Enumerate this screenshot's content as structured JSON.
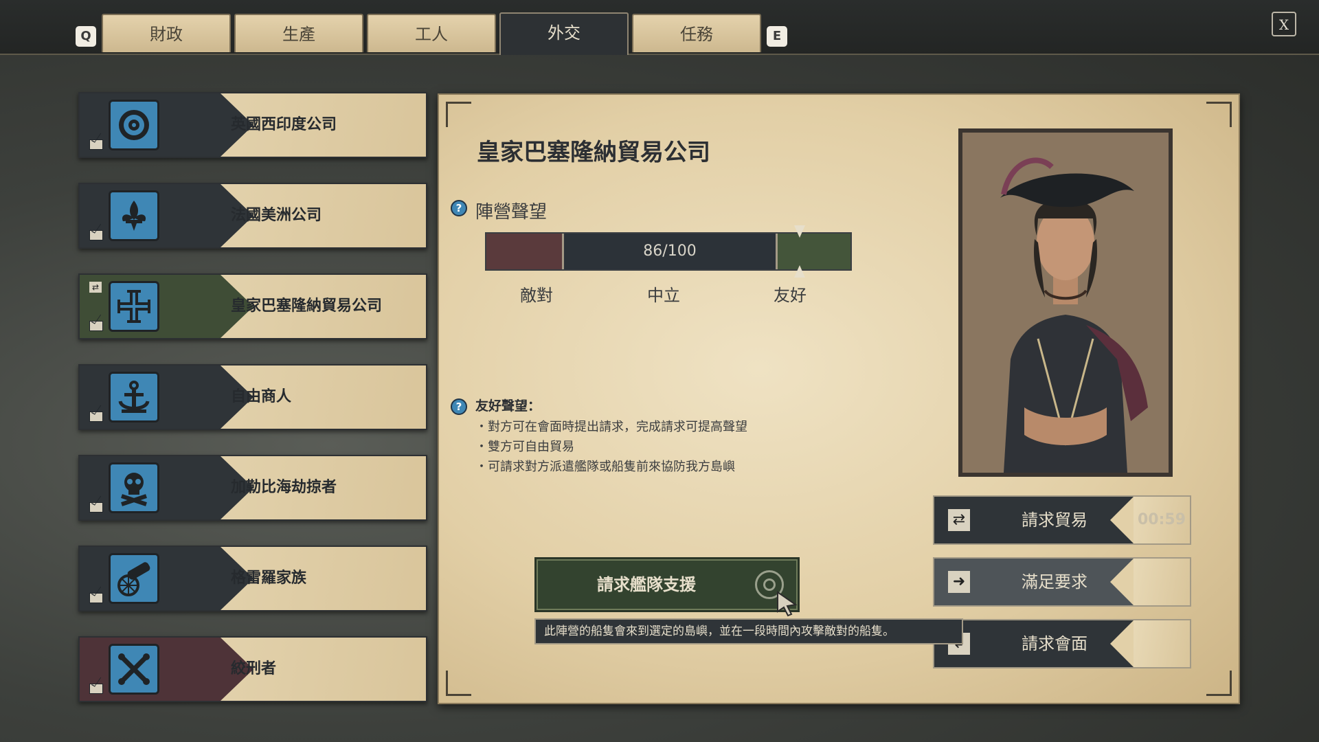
{
  "tabs": {
    "left_key": "Q",
    "right_key": "E",
    "items": [
      {
        "label": "財政"
      },
      {
        "label": "生產"
      },
      {
        "label": "工人"
      },
      {
        "label": "外交"
      },
      {
        "label": "任務"
      }
    ],
    "active_index": 3
  },
  "close_label": "X",
  "factions": [
    {
      "name": "英國西印度公司",
      "icon": "tudor-rose-icon",
      "status": "neutral"
    },
    {
      "name": "法國美洲公司",
      "icon": "fleur-de-lis-icon",
      "status": "neutral"
    },
    {
      "name": "皇家巴塞隆納貿易公司",
      "icon": "cross-icon",
      "status": "friendly",
      "selected": true
    },
    {
      "name": "自由商人",
      "icon": "anchor-icon",
      "status": "neutral"
    },
    {
      "name": "加勒比海劫掠者",
      "icon": "skull-crossbones-icon",
      "status": "neutral"
    },
    {
      "name": "格雷羅家族",
      "icon": "cannon-icon",
      "status": "neutral"
    },
    {
      "name": "絞刑者",
      "icon": "crossed-bones-icon",
      "status": "hostile"
    }
  ],
  "detail": {
    "title": "皇家巴塞隆納貿易公司",
    "reputation_label": "陣營聲望",
    "reputation_value": "86/100",
    "reputation_fraction": 0.86,
    "scale_labels": {
      "hostile": "敵對",
      "neutral": "中立",
      "friendly": "友好"
    },
    "info_heading": "友好聲望：",
    "info_lines": [
      "・對方可在會面時提出請求，完成請求可提高聲望",
      "・雙方可自由貿易",
      "・可請求對方派遣艦隊或船隻前來協防我方島嶼"
    ],
    "fleet_button": "請求艦隊支援",
    "tooltip": "此陣營的船隻會來到選定的島嶼，並在一段時間內攻擊敵對的船隻。",
    "actions": {
      "trade": "請求貿易",
      "trade_timer": "00:59",
      "satisfy": "滿足要求",
      "meeting": "請求會面"
    }
  },
  "colors": {
    "parchment": "#e6d4ad",
    "dark_band": "#2f3438",
    "friendly_green": "#44553a",
    "hostile_red": "#5a3a3c",
    "crest_blue": "#3f87b5"
  }
}
